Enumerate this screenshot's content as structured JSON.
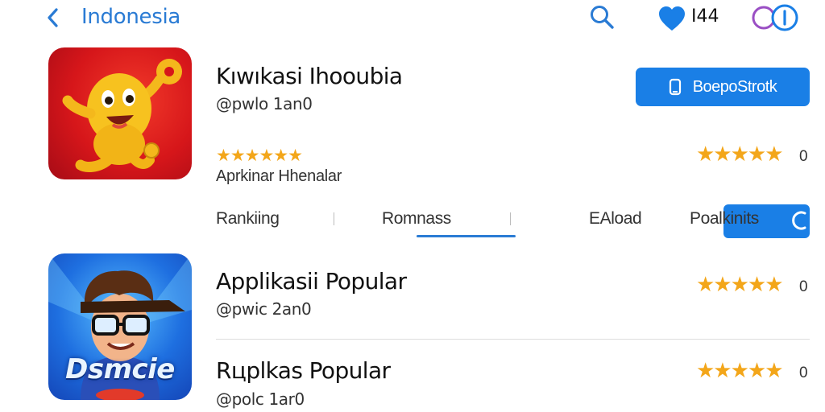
{
  "header": {
    "back_label": "Indonesia",
    "heart_count": "I44"
  },
  "featured": {
    "title": "Kıwıkasi Ihooubia",
    "subtitle": "@pwlo 1an0",
    "stars_small": "★★★★★★",
    "category": "Aprkinar Hhenalar",
    "get_button_label": "BoepoStrotk",
    "rating_stars": "★★★★★",
    "rating_count": "0"
  },
  "tabs": [
    {
      "label": "Rankiing"
    },
    {
      "label": "Romnass",
      "selected": true
    },
    {
      "label": "EAload"
    },
    {
      "label": "Poalkinits"
    }
  ],
  "list": [
    {
      "title": "Applikasii Popular",
      "subtitle": "@pwic 2an0",
      "rating_stars": "★★★★★",
      "rating_count": "0",
      "icon_text": "Dsmcie"
    },
    {
      "title": "Rцplkas Popular",
      "subtitle": "@polc 1ar0",
      "rating_stars": "★★★★★",
      "rating_count": "0"
    }
  ],
  "colors": {
    "accent": "#1a7fe6",
    "link": "#2a7bd4",
    "star": "#f3a61a",
    "icon1_bg": "#d6161a",
    "icon2_bg": "#1e6fe0"
  },
  "icons": {
    "back": "chevron-left-icon",
    "search": "search-icon",
    "heart": "heart-icon",
    "profile": "profile-icon",
    "get": "phone-icon"
  }
}
